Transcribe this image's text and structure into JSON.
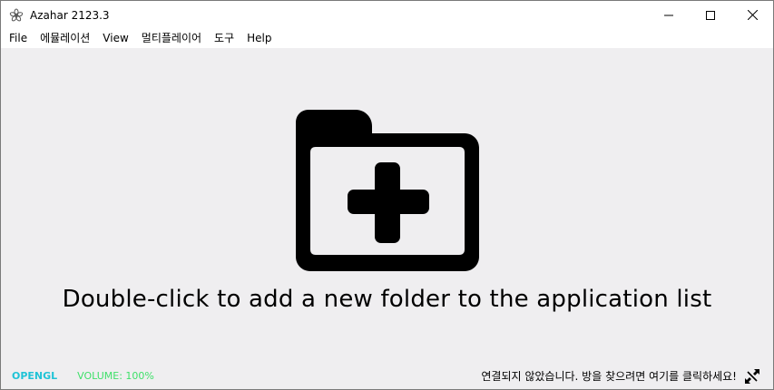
{
  "window": {
    "title": "Azahar 2123.3",
    "icon": "azahar-flower-icon"
  },
  "menu": {
    "items": [
      {
        "label": "File"
      },
      {
        "label": "에뮬레이션"
      },
      {
        "label": "View"
      },
      {
        "label": "멀티플레이어"
      },
      {
        "label": "도구"
      },
      {
        "label": "Help"
      }
    ]
  },
  "main": {
    "placeholder_icon": "add-folder-icon",
    "placeholder_text": "Double-click to add a new folder to the application list"
  },
  "status": {
    "graphics_api": "OPENGL",
    "graphics_api_color": "#1fc3d6",
    "volume": "VOLUME: 100%",
    "volume_color": "#3fe06a",
    "network_message": "연결되지 않았습니다.  방을 찾으려면 여기를 클릭하세요!",
    "network_icon": "disconnected-icon"
  }
}
